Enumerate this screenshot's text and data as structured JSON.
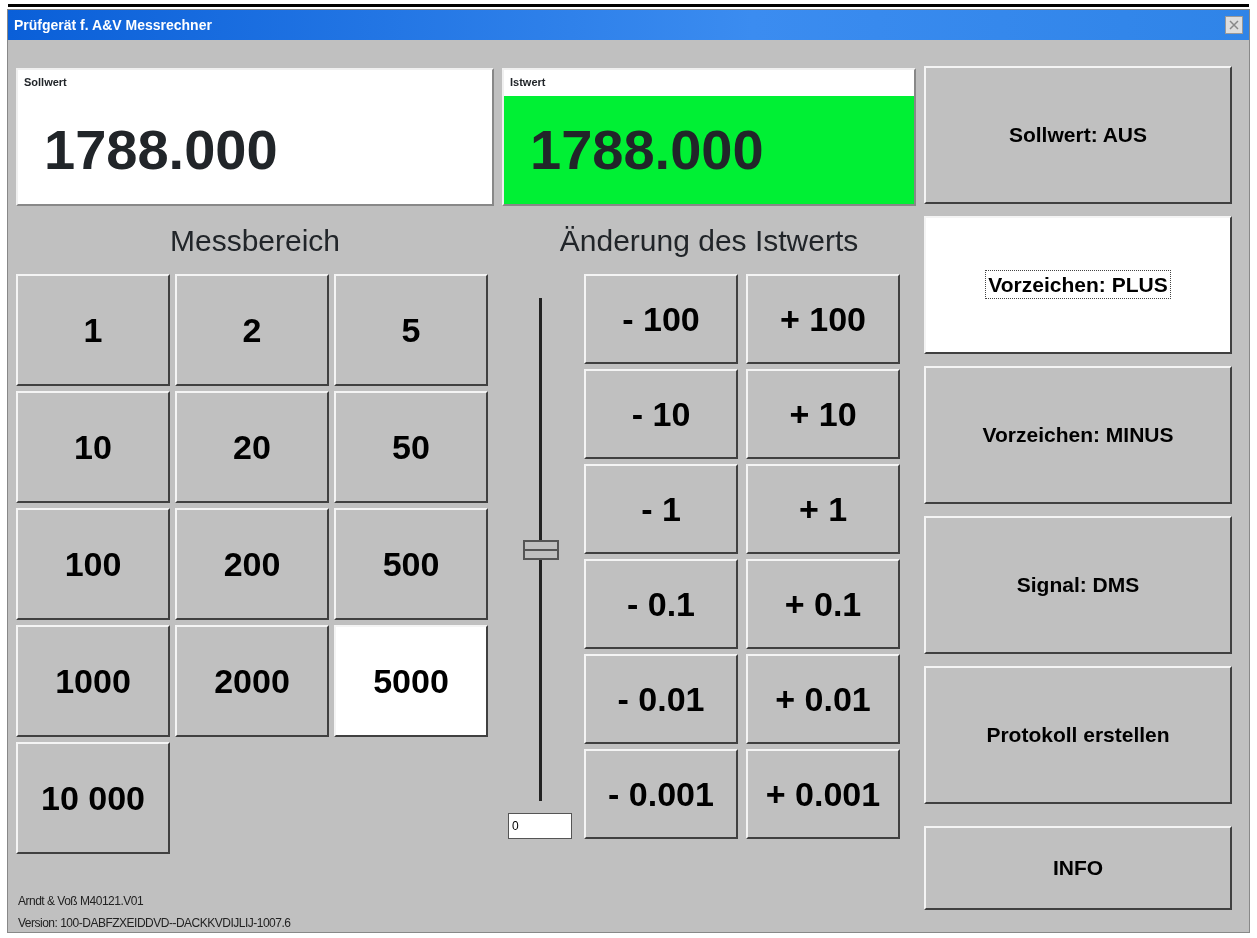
{
  "window": {
    "title": "Prüfgerät f. A&V Messrechner"
  },
  "displays": [
    {
      "label": "Sollwert",
      "value": "1788.000",
      "color": "#ffffff"
    },
    {
      "label": "Istwert",
      "value": "1788.000",
      "color": "#00f034"
    }
  ],
  "range": {
    "heading": "Messbereich",
    "buttons": [
      {
        "label": "1",
        "selected": false
      },
      {
        "label": "2",
        "selected": false
      },
      {
        "label": "5",
        "selected": false
      },
      {
        "label": "10",
        "selected": false
      },
      {
        "label": "20",
        "selected": false
      },
      {
        "label": "50",
        "selected": false
      },
      {
        "label": "100",
        "selected": false
      },
      {
        "label": "200",
        "selected": false
      },
      {
        "label": "500",
        "selected": false
      },
      {
        "label": "1000",
        "selected": false
      },
      {
        "label": "2000",
        "selected": false
      },
      {
        "label": "5000",
        "selected": true
      },
      {
        "label": "10 000",
        "selected": false
      }
    ]
  },
  "change": {
    "heading": "Änderung des Istwerts",
    "slider": {
      "level": 0.5
    },
    "slider_value": "0",
    "steps": [
      [
        "- 100",
        "+ 100"
      ],
      [
        "- 10",
        "+ 10"
      ],
      [
        "- 1",
        "+ 1"
      ],
      [
        "- 0.1",
        "+ 0.1"
      ],
      [
        "- 0.01",
        "+ 0.01"
      ],
      [
        "- 0.001",
        "+ 0.001"
      ]
    ]
  },
  "actions": [
    {
      "label": "Sollwert: AUS",
      "selected": false
    },
    {
      "label": "Vorzeichen: PLUS",
      "selected": true
    },
    {
      "label": "Vorzeichen: MINUS",
      "selected": false
    },
    {
      "label": "Signal: DMS",
      "selected": false
    },
    {
      "label": "Protokoll erstellen",
      "selected": false
    },
    {
      "label": "INFO",
      "selected": false
    }
  ],
  "footer": [
    "Arndt & Voß  M40121.V01",
    "Version: 100-DABFZXEIDDVD--DACKKVDIJLIJ-1007.6"
  ]
}
